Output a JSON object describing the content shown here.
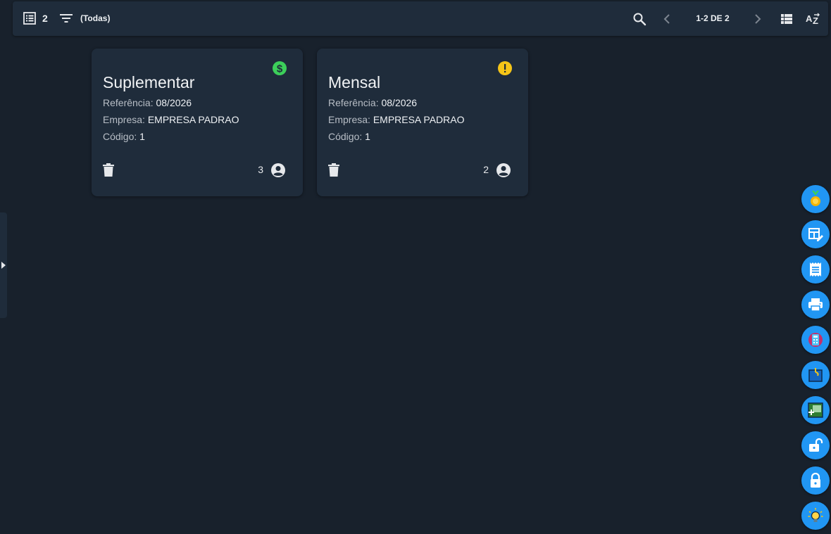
{
  "toolbar": {
    "count": "2",
    "filter_label": "(Todas)",
    "pagination": "1-2 DE 2",
    "icons": [
      "list-icon",
      "filter-icon",
      "search-icon",
      "chevron-left-icon",
      "chevron-right-icon",
      "view-list-icon",
      "sort-az-icon"
    ]
  },
  "cards": [
    {
      "title": "Suplementar",
      "referencia_label": "Referência:",
      "referencia_value": "08/2026",
      "empresa_label": "Empresa:",
      "empresa_value": "EMPRESA PADRAO",
      "codigo_label": "Código:",
      "codigo_value": "1",
      "count": "3",
      "status_icon": "dollar-icon",
      "status_color": "#3ccf5a"
    },
    {
      "title": "Mensal",
      "referencia_label": "Referência:",
      "referencia_value": "08/2026",
      "empresa_label": "Empresa:",
      "empresa_value": "EMPRESA PADRAO",
      "codigo_label": "Código:",
      "codigo_value": "1",
      "count": "2",
      "status_icon": "alert-icon",
      "status_color": "#f5c518"
    }
  ],
  "fab_actions": [
    "medal-icon",
    "table-edit-icon",
    "receipt-icon",
    "printer-icon",
    "calculator-icon",
    "calendar-icon",
    "add-box-icon",
    "lock-open-icon",
    "lock-icon",
    "lightbulb-icon"
  ],
  "colors": {
    "background": "#18212c",
    "surface": "#1f2c3b",
    "accent": "#2196f3"
  }
}
